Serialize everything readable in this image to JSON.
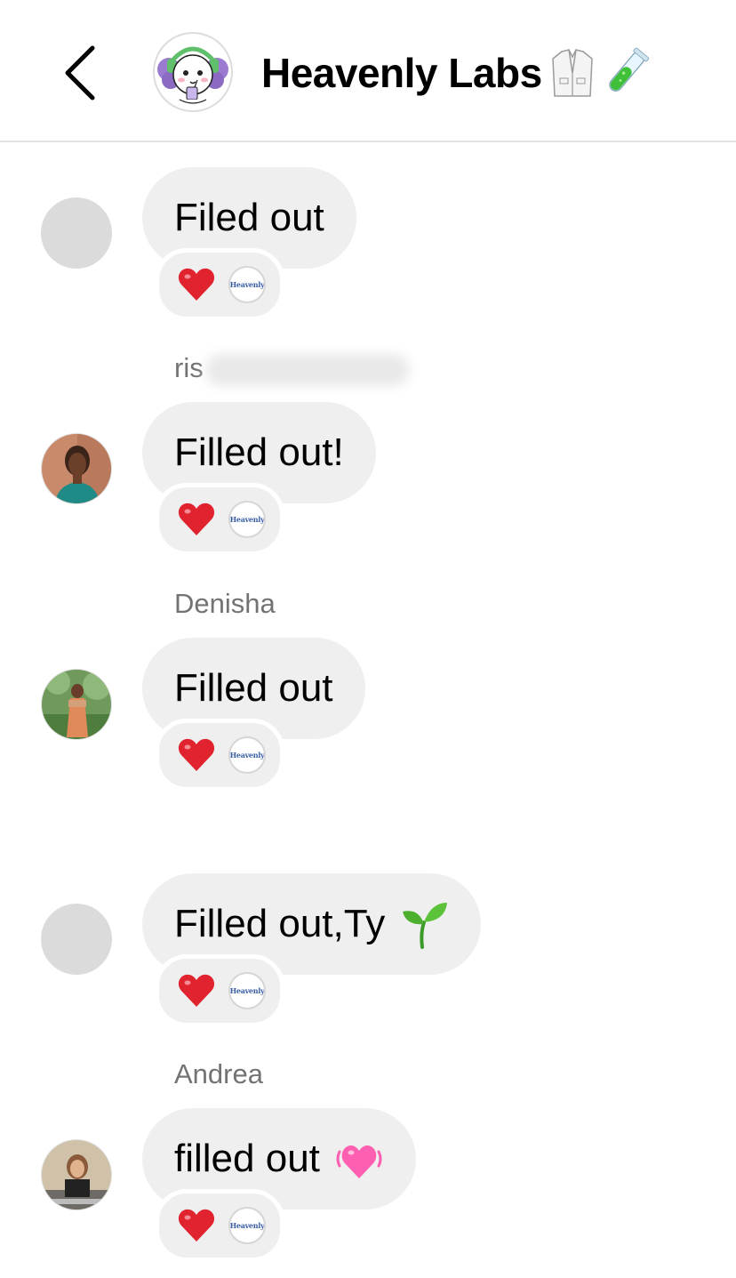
{
  "header": {
    "title": "Heavenly Labs",
    "title_emojis": [
      "lab-coat",
      "test-tube"
    ]
  },
  "reaction_logo_text": "Heavenly",
  "messages": [
    {
      "sender": "",
      "text": "Filed out",
      "reactions": [
        "❤️",
        "Heavenly"
      ]
    },
    {
      "sender": "ris",
      "text": "Filled out!",
      "reactions": [
        "❤️",
        "Heavenly"
      ]
    },
    {
      "sender": "Denisha",
      "text": "Filled out",
      "reactions": [
        "❤️",
        "Heavenly"
      ]
    },
    {
      "sender": "",
      "text": "Filled out,Ty",
      "emoji": "seedling",
      "reactions": [
        "❤️",
        "Heavenly"
      ]
    },
    {
      "sender": "Andrea",
      "text": "filled out",
      "emoji": "beating-heart",
      "reactions": [
        "❤️",
        "Heavenly"
      ]
    }
  ],
  "colors": {
    "bubble": "#efefef",
    "sender": "#737373",
    "heart": "#e0232e",
    "seedling": "#4caf2e",
    "pink_heart": "#ff5fb0"
  }
}
